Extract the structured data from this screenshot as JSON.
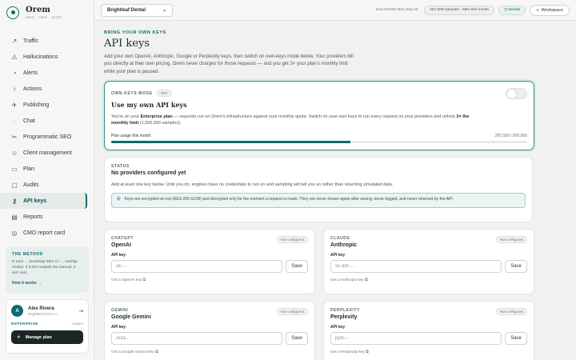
{
  "brand": {
    "name": "Orem",
    "sub": "SEO · AEO · AIAO"
  },
  "sidebar": {
    "items": [
      {
        "label": "Traffic",
        "icon": "↗"
      },
      {
        "label": "Hallucinations",
        "icon": "⚠"
      },
      {
        "label": "Alerts",
        "icon": "◔"
      },
      {
        "label": "Actions",
        "icon": "♀"
      },
      {
        "label": "Publishing",
        "icon": "✈"
      },
      {
        "label": "Chat",
        "icon": "◌"
      },
      {
        "label": "Programmatic SEO",
        "icon": "✂"
      },
      {
        "label": "Client management",
        "icon": "☺"
      },
      {
        "label": "Plan",
        "icon": "▭"
      },
      {
        "label": "Audits",
        "icon": "▢"
      },
      {
        "label": "API keys",
        "icon": "⚷"
      },
      {
        "label": "Reports",
        "icon": "▤"
      },
      {
        "label": "CMO report card",
        "icon": "◎"
      }
    ],
    "active_index": 10,
    "method": {
      "title": "THE METHOD",
      "text": "N runs → bootstrap 95% CI → overlap verdict. If it isn't outside the interval, it isn't real.",
      "link": "How it works →"
    },
    "user": {
      "initial": "A",
      "name": "Alex Rivera",
      "org": "Brightleaf Demo A...",
      "plan": "ENTERPRISE",
      "plan_kind": "custom",
      "manage_label": "Manage plan"
    }
  },
  "topbar": {
    "org": "Brightleaf Dental",
    "refresh": "next refresh Mon Sep 23",
    "samples": "287,509 samples · 58% this month",
    "details": "Details",
    "workspace": "Workspace"
  },
  "page": {
    "eyebrow": "BRING YOUR OWN KEYS",
    "title": "API keys",
    "intro": "Add your own OpenAI, Anthropic, Google or Perplexity keys, then switch on own-keys mode below. Your providers bill you directly at their own pricing, Orem never charges for those requests — and you get 3× your plan's monthly limit while your plan is paused."
  },
  "own_keys": {
    "label": "OWN-KEYS MODE",
    "state": "OFF",
    "title": "Use my own API keys",
    "desc_1": "You're on your ",
    "desc_plan": "Enterprise plan",
    "desc_2": " — requests run on Orem's infrastructure against your monthly quota. Switch on your own keys to run every request on your providers and unlock ",
    "desc_limit": "3× the monthly limit",
    "desc_3": " (1,500,000 samples).",
    "usage_label": "Plan usage this month",
    "usage_value": "287,509 / 500,000",
    "usage_fraction": 0.575
  },
  "status": {
    "label": "STATUS",
    "title": "No providers configured yet",
    "desc": "Add at least one key below. Until you do, engines have no credentials to run on and sampling will tell you so rather than returning simulated data.",
    "note": "Keys are encrypted at rest (AES-256-GCM) and decrypted only for the moment a request is made. They are never shown again after saving, never logged, and never returned by the API."
  },
  "providers": [
    {
      "eyebrow": "CHATGPT",
      "name": "OpenAI",
      "badge": "Not configured",
      "key_label": "API key",
      "placeholder": "sk-...",
      "save": "Save",
      "link": "Get a OpenAI key ⧉"
    },
    {
      "eyebrow": "CLAUDE",
      "name": "Anthropic",
      "badge": "Not configured",
      "key_label": "API key",
      "placeholder": "sk-ant-...",
      "save": "Save",
      "link": "Get a Anthropic key ⧉"
    },
    {
      "eyebrow": "GEMINI",
      "name": "Google Gemini",
      "badge": "Not configured",
      "key_label": "API key",
      "placeholder": "AIza...",
      "save": "Save",
      "link": "Get a Google Gemini key ⧉"
    },
    {
      "eyebrow": "PERPLEXITY",
      "name": "Perplexity",
      "badge": "Not configured",
      "key_label": "API key",
      "placeholder": "pplx-...",
      "save": "Save",
      "link": "Get a Perplexity key ⧉"
    }
  ],
  "colors": {
    "accent": "#0f6b6b",
    "background": "#f1f2f0"
  }
}
